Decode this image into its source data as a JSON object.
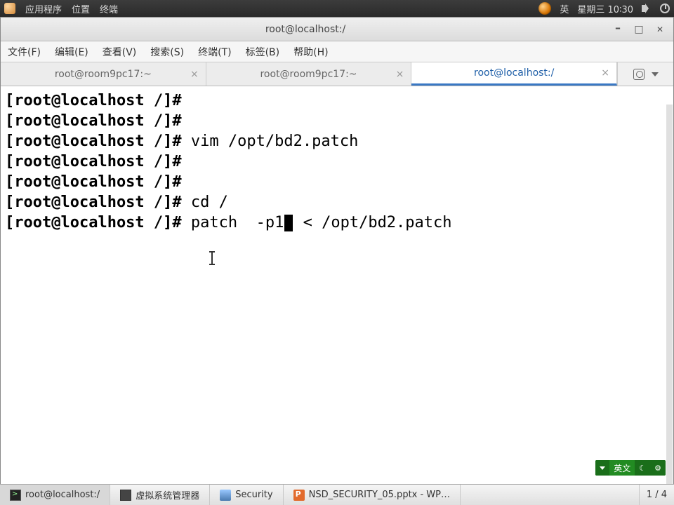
{
  "top_panel": {
    "apps": "应用程序",
    "places": "位置",
    "terminal": "终端",
    "ime_short": "英",
    "datetime": "星期三 10∶30"
  },
  "window": {
    "title": "root@localhost:/"
  },
  "menubar": {
    "file": "文件(F)",
    "edit": "编辑(E)",
    "view": "查看(V)",
    "search": "搜索(S)",
    "terminal": "终端(T)",
    "tabs": "标签(B)",
    "help": "帮助(H)"
  },
  "tabs": [
    {
      "label": "root@room9pc17:~",
      "active": false
    },
    {
      "label": "root@room9pc17:~",
      "active": false
    },
    {
      "label": "root@localhost:/",
      "active": true
    }
  ],
  "terminal": {
    "prompt": "[root@localhost /]# ",
    "lines": [
      "",
      "",
      "vim /opt/bd2.patch",
      "",
      "",
      "cd /"
    ],
    "current_before": "patch  -p1",
    "current_after": " < /opt/bd2.patch"
  },
  "ime_badge": {
    "label": "英文"
  },
  "taskbar": {
    "items": [
      {
        "label": "root@localhost:/"
      },
      {
        "label": "虚拟系统管理器"
      },
      {
        "label": "Security"
      },
      {
        "label": "NSD_SECURITY_05.pptx - WP…"
      }
    ],
    "desk_indicator": "1 / 4"
  }
}
